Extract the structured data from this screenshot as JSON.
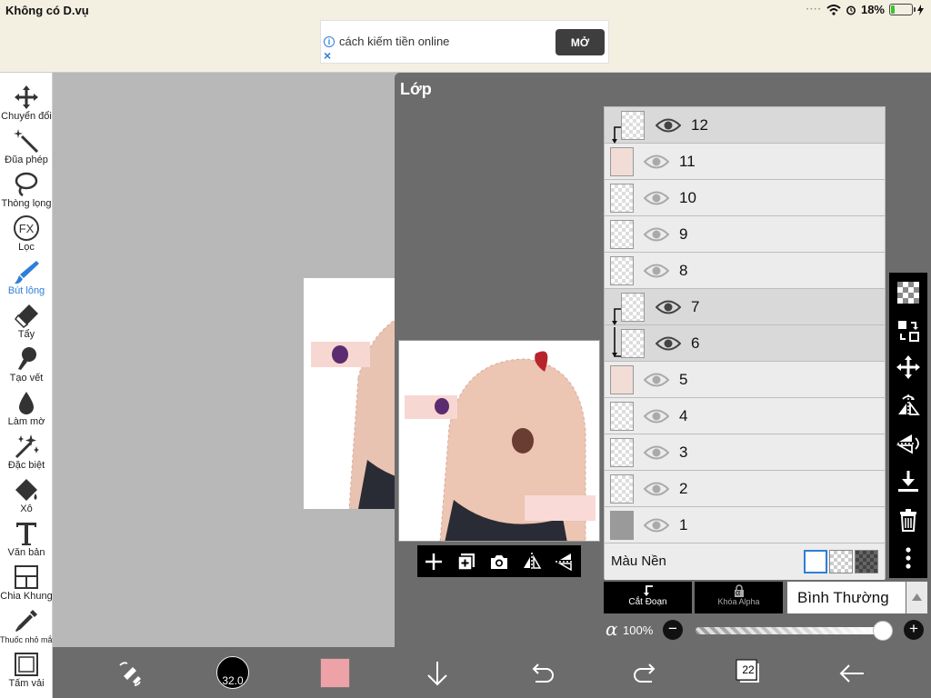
{
  "status_bar": {
    "carrier": "Không có D.vụ",
    "battery": "18%"
  },
  "ad": {
    "text": "cách kiếm tiền online",
    "button": "MỞ"
  },
  "tools": [
    {
      "label": "Chuyển đổi",
      "icon": "move-icon"
    },
    {
      "label": "Đũa phép",
      "icon": "magic-wand-icon"
    },
    {
      "label": "Thòng lọng",
      "icon": "lasso-icon"
    },
    {
      "label": "Lọc",
      "icon": "fx-filter-icon"
    },
    {
      "label": "Bút lông",
      "icon": "brush-icon"
    },
    {
      "label": "Tẩy",
      "icon": "eraser-icon"
    },
    {
      "label": "Tạo vết",
      "icon": "smudge-icon"
    },
    {
      "label": "Làm mờ",
      "icon": "blur-drop-icon"
    },
    {
      "label": "Đặc biệt",
      "icon": "sparkle-icon"
    },
    {
      "label": "Xô",
      "icon": "bucket-icon"
    },
    {
      "label": "Văn bản",
      "icon": "text-icon"
    },
    {
      "label": "Chia Khung",
      "icon": "frame-divider-icon"
    },
    {
      "label": "Thuốc nhỏ mắt",
      "icon": "eyedropper-icon"
    },
    {
      "label": "Tấm vải",
      "icon": "canvas-icon"
    }
  ],
  "active_tool": "Bút lông",
  "layer_panel": {
    "title": "Lớp",
    "layers": [
      "12",
      "11",
      "10",
      "9",
      "8",
      "7",
      "6",
      "5",
      "4",
      "3",
      "2",
      "1"
    ],
    "background_label": "Màu Nền",
    "clip_button": "Cắt Đoạn",
    "alpha_lock_button": "Khóa Alpha",
    "alpha_lock_symbol": "α",
    "blend_mode": "Bình Thường",
    "opacity_symbol": "α",
    "opacity": "100%",
    "minus": "−",
    "plus": "+"
  },
  "bottom_bar": {
    "brush_size": "32.0",
    "layer_count": "22",
    "color": "#eda2a8"
  },
  "colors": {
    "accent": "#2d7fd8",
    "panel": "#6c6c6c",
    "toolbar_bg": "#ffffff"
  }
}
